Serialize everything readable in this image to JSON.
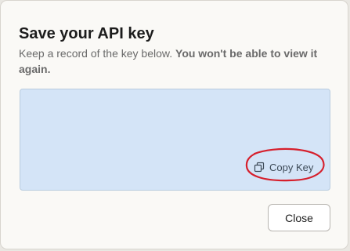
{
  "dialog": {
    "title": "Save your API key",
    "description_plain": "Keep a record of the key below. ",
    "description_strong": "You won't be able to view it again.",
    "key_value": "",
    "copy_label": "Copy Key",
    "close_label": "Close"
  },
  "icons": {
    "copy": "copy-icon"
  },
  "colors": {
    "key_box_bg": "#d4e4f7",
    "annotation": "#d61f2c"
  }
}
